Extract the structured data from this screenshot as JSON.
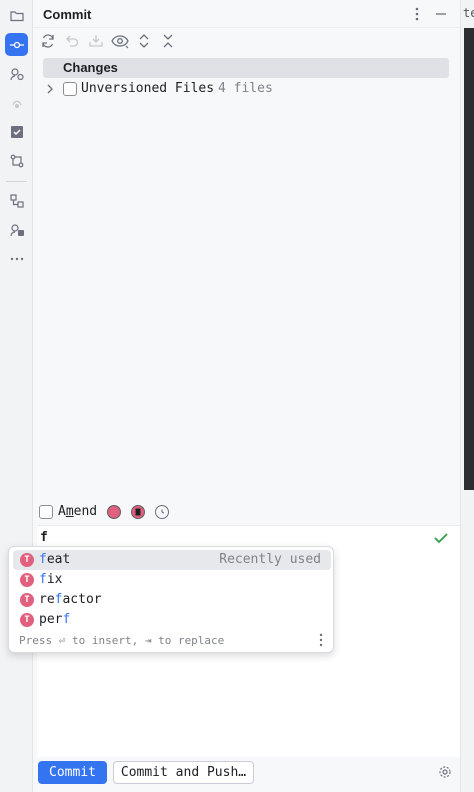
{
  "strip": {
    "items": [
      "project-icon",
      "commit-icon",
      "pull-requests-icon",
      "debug-icon",
      "todo-icon",
      "git-branches-icon",
      "structure-icon",
      "services-icon",
      "more-icon"
    ]
  },
  "header": {
    "title": "Commit"
  },
  "changes": {
    "group_label": "Changes",
    "unversioned_label": "Unversioned Files",
    "unversioned_count": "4 files"
  },
  "amend": {
    "label_pre": "A",
    "label_underline": "m",
    "label_post": "end"
  },
  "message": {
    "text": "f"
  },
  "completion": {
    "items": [
      {
        "highlight": "f",
        "rest": "eat",
        "note": "Recently used"
      },
      {
        "highlight": "f",
        "rest": "ix"
      },
      {
        "pre": "re",
        "highlight": "f",
        "rest": "actor"
      },
      {
        "pre": "per",
        "highlight": "f",
        "rest": ""
      }
    ],
    "badge": "T",
    "hint": "Press ⏎ to insert, ⇥ to replace"
  },
  "buttons": {
    "commit": "Commit",
    "commit_push": "Commit and Push…"
  },
  "right_edge": {
    "cut_text": "te"
  },
  "colors": {
    "accent": "#3574f0",
    "badge": "#e0607e",
    "check": "#2f9e44"
  }
}
